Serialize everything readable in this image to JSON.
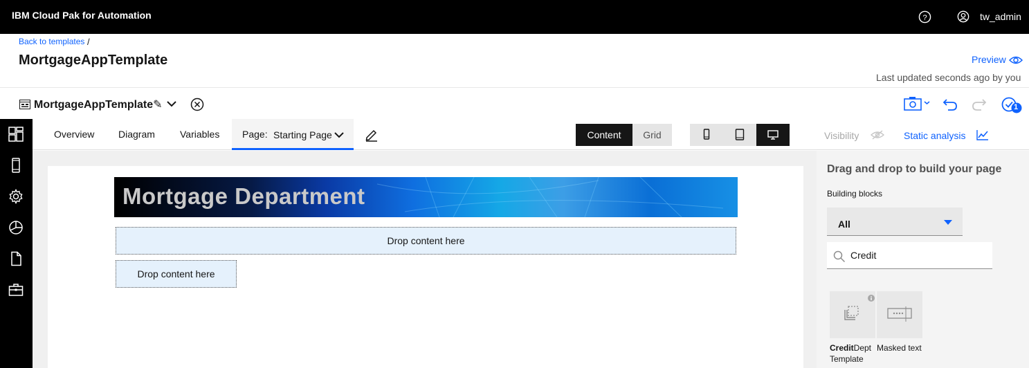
{
  "topbar": {
    "brand": "IBM Cloud Pak for Automation",
    "username": "tw_admin"
  },
  "header": {
    "breadcrumb": "Back to templates",
    "breadcrumb_sep": "/",
    "title": "MortgageAppTemplate",
    "preview": "Preview",
    "last_updated": "Last updated seconds ago by you"
  },
  "editor_bar": {
    "name": "MortgageAppTemplate✎",
    "badge_count": "1"
  },
  "tabs": {
    "overview": "Overview",
    "diagram": "Diagram",
    "variables": "Variables",
    "page_label": "Page:",
    "page_value": "Starting Page"
  },
  "view_toggle": {
    "content": "Content",
    "grid": "Grid"
  },
  "right_links": {
    "visibility": "Visibility",
    "static_analysis": "Static analysis"
  },
  "canvas": {
    "banner_text": "Mortgage Department",
    "drop_full": "Drop content here",
    "drop_small": "Drop content here"
  },
  "palette": {
    "title": "Drag and drop to build your page",
    "building_blocks_label": "Building blocks",
    "filter_value": "All",
    "search_value": "Credit",
    "blocks": [
      {
        "label_bold": "Credit",
        "label_rest": "Dept",
        "label_line2": "Template",
        "icon": "template-icon"
      },
      {
        "label": "Masked text",
        "icon": "masked-text-icon"
      }
    ]
  },
  "colors": {
    "accent": "#0f62fe",
    "topbar": "#000000",
    "drop_zone": "#e5f1fc"
  }
}
